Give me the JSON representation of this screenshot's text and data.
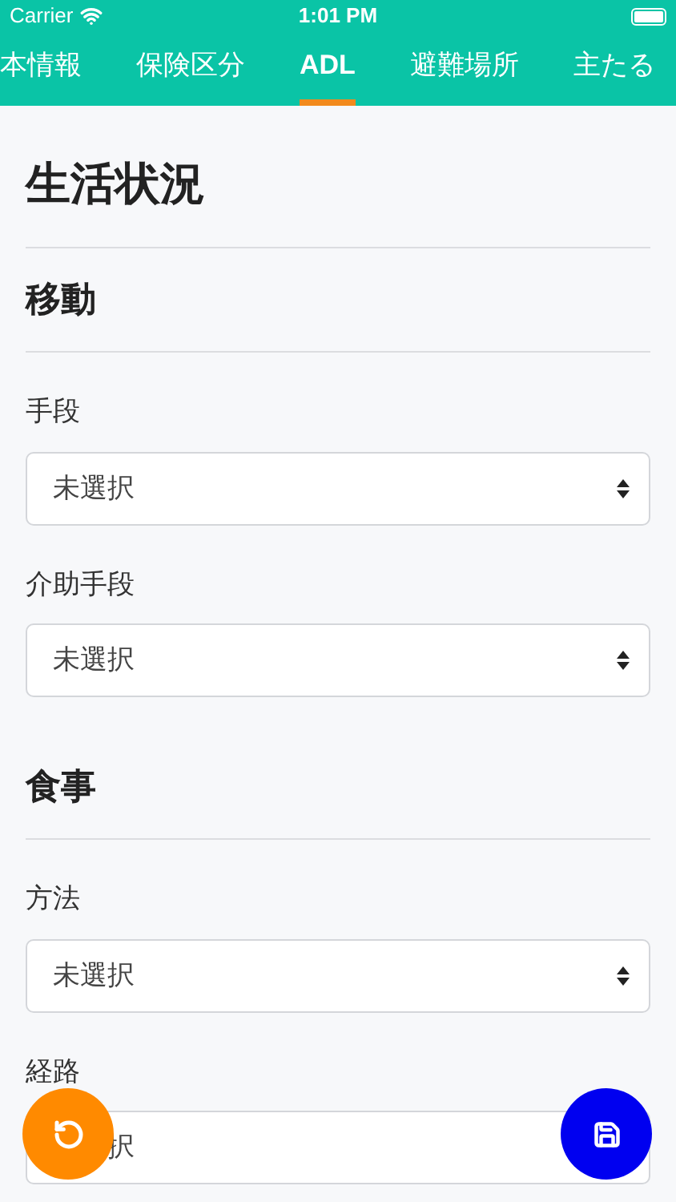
{
  "status_bar": {
    "carrier": "Carrier",
    "time": "1:01 PM"
  },
  "tabs": [
    {
      "label": "本情報",
      "selected": false
    },
    {
      "label": "保険区分",
      "selected": false
    },
    {
      "label": "ADL",
      "selected": true
    },
    {
      "label": "避難場所",
      "selected": false
    },
    {
      "label": "主たる",
      "selected": false
    }
  ],
  "page_title": "生活状況",
  "sections": [
    {
      "title": "移動",
      "fields": [
        {
          "label": "手段",
          "value": "未選択",
          "covered": false
        },
        {
          "label": "介助手段",
          "value": "未選択",
          "covered": false
        }
      ]
    },
    {
      "title": "食事",
      "fields": [
        {
          "label": "方法",
          "value": "未選択",
          "covered": false
        },
        {
          "label": "経路",
          "value": "択",
          "covered": true
        }
      ]
    }
  ]
}
